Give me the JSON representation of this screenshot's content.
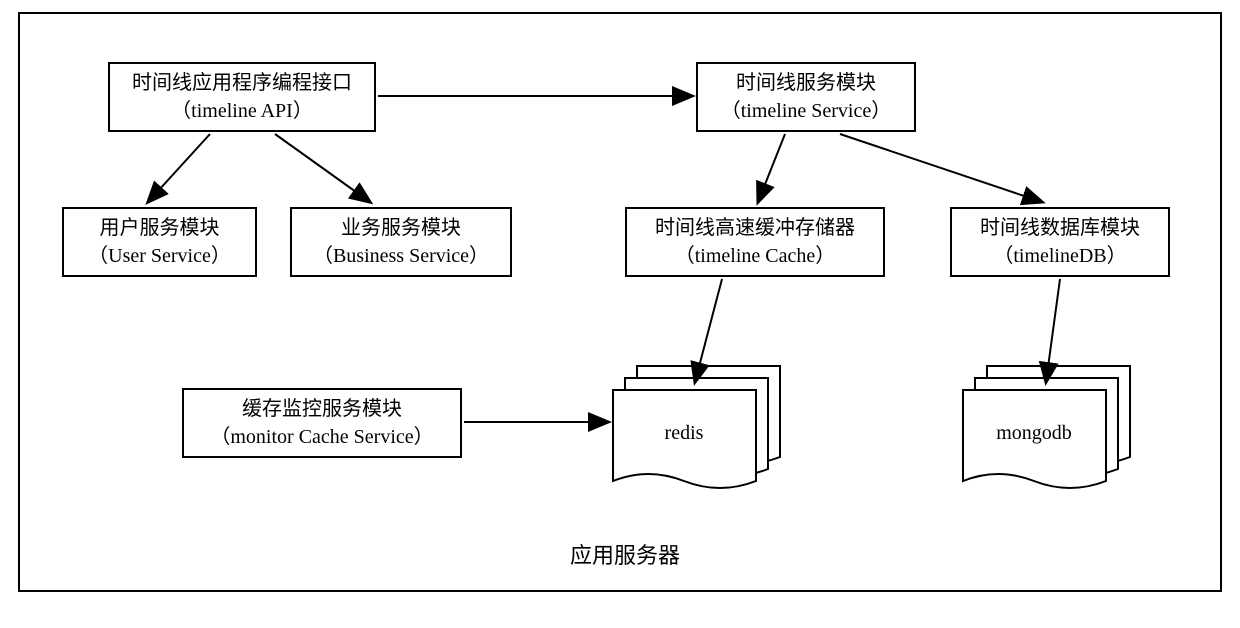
{
  "boxes": {
    "timeline_api": {
      "line1": "时间线应用程序编程接口",
      "line2": "（timeline API）"
    },
    "timeline_service": {
      "line1": "时间线服务模块",
      "line2": "（timeline Service）"
    },
    "user_service": {
      "line1": "用户服务模块",
      "line2": "（User Service）"
    },
    "business_service": {
      "line1": "业务服务模块",
      "line2": "（Business Service）"
    },
    "timeline_cache": {
      "line1": "时间线高速缓冲存储器",
      "line2": "（timeline Cache）"
    },
    "timeline_db": {
      "line1": "时间线数据库模块",
      "line2": "（timelineDB）"
    },
    "monitor_cache": {
      "line1": "缓存监控服务模块",
      "line2": "（monitor Cache Service）"
    }
  },
  "stacks": {
    "redis": "redis",
    "mongodb": "mongodb"
  },
  "caption": "应用服务器"
}
